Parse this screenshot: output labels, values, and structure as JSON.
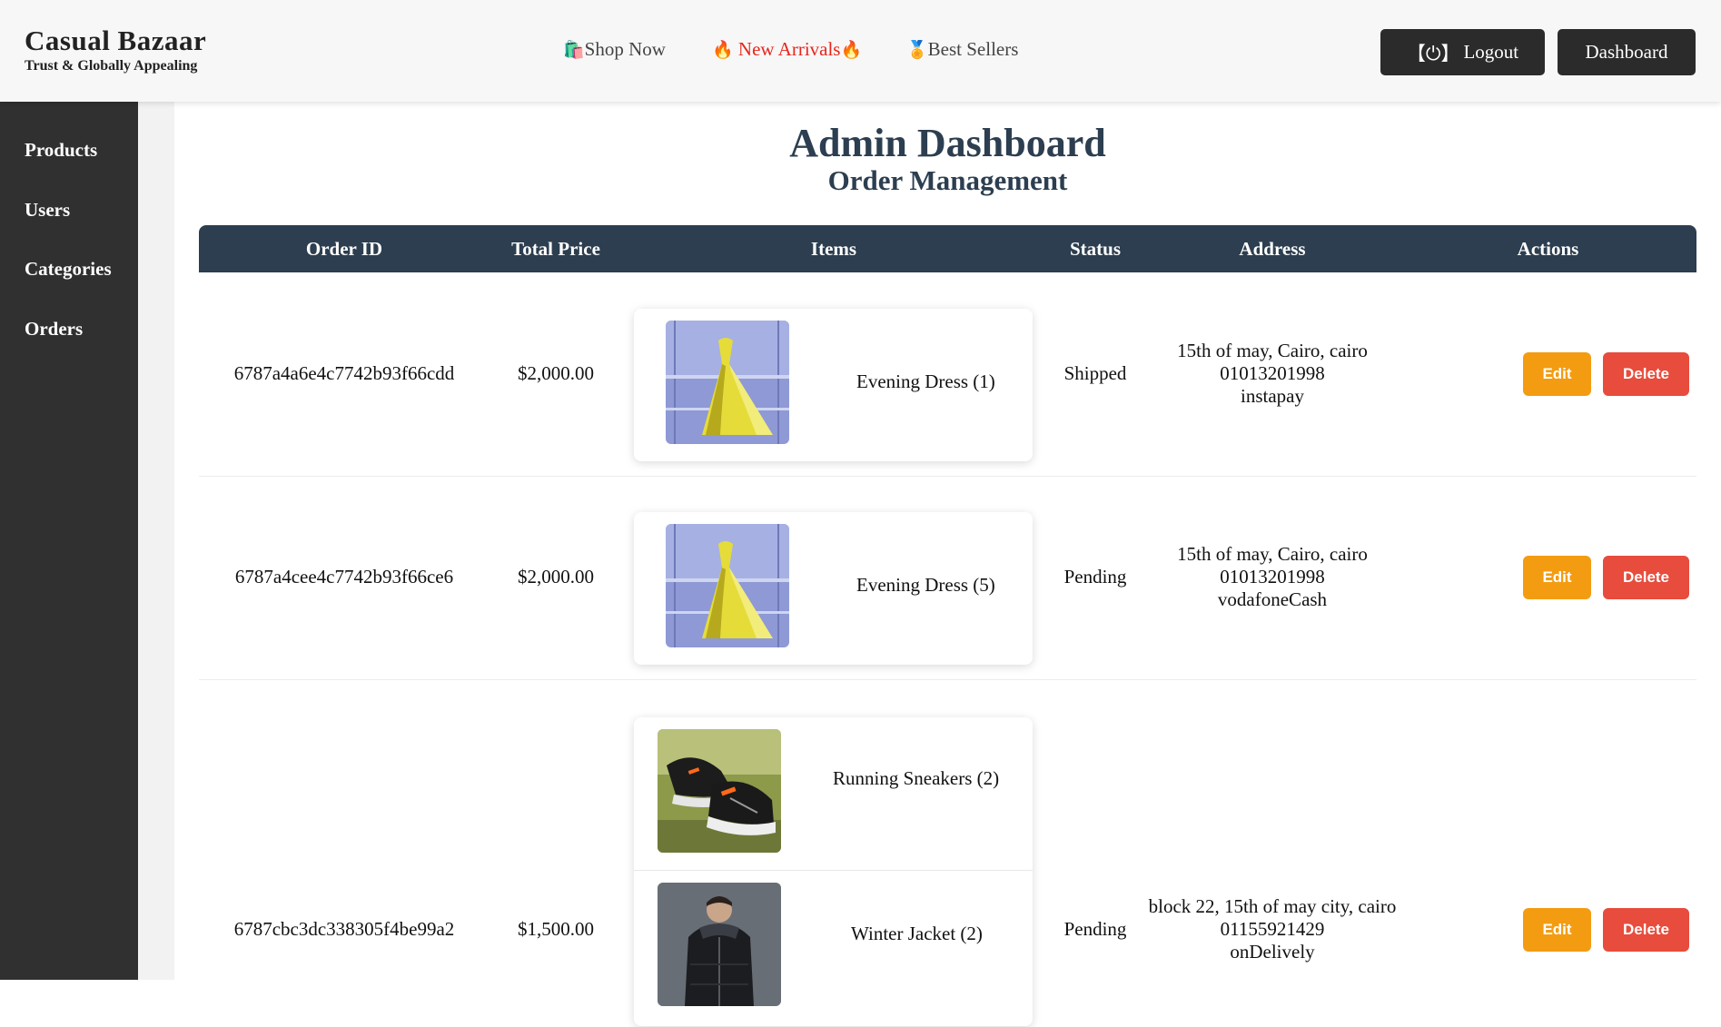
{
  "brand": {
    "title": "Casual Bazaar",
    "tagline": "Trust & Globally Appealing"
  },
  "nav": {
    "shop": {
      "icon": "🛍️",
      "label": "Shop Now"
    },
    "new_arrivals": {
      "icon": "🔥",
      "label": "New Arrivals",
      "icon_after": "🔥"
    },
    "best_sellers": {
      "icon": "🏅",
      "label": "Best Sellers"
    }
  },
  "header_buttons": {
    "logout_icon": "【⏻】",
    "logout": "Logout",
    "dashboard": "Dashboard"
  },
  "sidebar": {
    "items": [
      "Products",
      "Users",
      "Categories",
      "Orders"
    ]
  },
  "page": {
    "title": "Admin Dashboard",
    "subtitle": "Order Management"
  },
  "table": {
    "headers": [
      "Order ID",
      "Total Price",
      "Items",
      "Status",
      "Address",
      "Actions"
    ],
    "edit_label": "Edit",
    "delete_label": "Delete",
    "orders": [
      {
        "id": "6787a4a6e4c7742b93f66cdd",
        "total": "$2,000.00",
        "items": [
          {
            "name": "Evening Dress (1)",
            "image": "evening-dress"
          }
        ],
        "status": "Shipped",
        "address": [
          "15th of may, Cairo, cairo",
          "01013201998",
          "instapay"
        ]
      },
      {
        "id": "6787a4cee4c7742b93f66ce6",
        "total": "$2,000.00",
        "items": [
          {
            "name": "Evening Dress (5)",
            "image": "evening-dress"
          }
        ],
        "status": "Pending",
        "address": [
          "15th of may, Cairo, cairo",
          "01013201998",
          "vodafoneCash"
        ]
      },
      {
        "id": "6787cbc3dc338305f4be99a2",
        "total": "$1,500.00",
        "items": [
          {
            "name": "Running Sneakers (2)",
            "image": "running-sneakers"
          },
          {
            "name": "Winter Jacket (2)",
            "image": "winter-jacket"
          }
        ],
        "status": "Pending",
        "address": [
          "block 22, 15th of may city, cairo",
          "01155921429",
          "onDelively"
        ]
      }
    ]
  },
  "colors": {
    "header_bg": "#f7f7f7",
    "sidebar_bg": "#303030",
    "table_head_bg": "#2c3e50",
    "title_color": "#2c3e50",
    "edit_bg": "#f39c12",
    "delete_bg": "#e74c3c",
    "hot_link": "#e8251c"
  }
}
